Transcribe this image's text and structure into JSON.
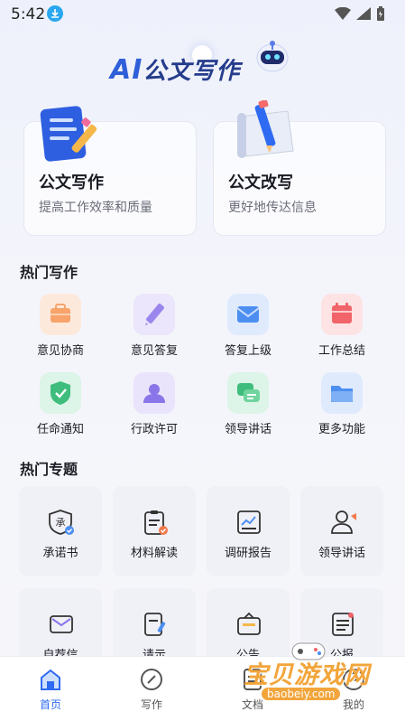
{
  "status": {
    "time": "5:42"
  },
  "hero": {
    "title_latin": "AI",
    "title_cn": "公文写作"
  },
  "cards": [
    {
      "title": "公文写作",
      "subtitle": "提高工作效率和质量",
      "icon": "document-pencil-icon"
    },
    {
      "title": "公文改写",
      "subtitle": "更好地传达信息",
      "icon": "scroll-pencil-icon"
    }
  ],
  "hot_writing": {
    "title": "热门写作",
    "items": [
      {
        "label": "意见协商",
        "icon": "briefcase-icon",
        "color": "#f7a36a"
      },
      {
        "label": "意见答复",
        "icon": "pencil-icon",
        "color": "#9b86ee"
      },
      {
        "label": "答复上级",
        "icon": "mail-icon",
        "color": "#4d8ff0"
      },
      {
        "label": "工作总结",
        "icon": "calendar-icon",
        "color": "#f0646a"
      },
      {
        "label": "任命通知",
        "icon": "shield-check-icon",
        "color": "#3fbd7c"
      },
      {
        "label": "行政许可",
        "icon": "person-icon",
        "color": "#8a76e8"
      },
      {
        "label": "领导讲话",
        "icon": "chat-icon",
        "color": "#3fbd7c"
      },
      {
        "label": "更多功能",
        "icon": "folder-icon",
        "color": "#4d8ff0"
      }
    ]
  },
  "hot_topics": {
    "title": "热门专题",
    "items": [
      {
        "label": "承诺书",
        "icon": "commitment-badge-icon",
        "glyph": "承"
      },
      {
        "label": "材料解读",
        "icon": "clipboard-check-icon"
      },
      {
        "label": "调研报告",
        "icon": "chart-report-icon"
      },
      {
        "label": "领导讲话",
        "icon": "speaker-person-icon"
      },
      {
        "label": "自荐信",
        "icon": "envelope-icon"
      },
      {
        "label": "请示",
        "icon": "document-edit-icon"
      },
      {
        "label": "公告",
        "icon": "notice-board-icon"
      },
      {
        "label": "公报",
        "icon": "bulletin-icon"
      }
    ]
  },
  "nav": [
    {
      "label": "首页",
      "icon": "home-icon",
      "active": true
    },
    {
      "label": "写作",
      "icon": "write-icon",
      "active": false
    },
    {
      "label": "文档",
      "icon": "document-icon",
      "active": false
    },
    {
      "label": "我的",
      "icon": "profile-icon",
      "active": false
    }
  ],
  "watermark": {
    "text": "宝贝游戏网",
    "url_text": "baobeiy.com"
  },
  "colors": {
    "accent": "#2f6bf2",
    "brand": "#2f5fd9",
    "watermark": "#f2a53b"
  }
}
